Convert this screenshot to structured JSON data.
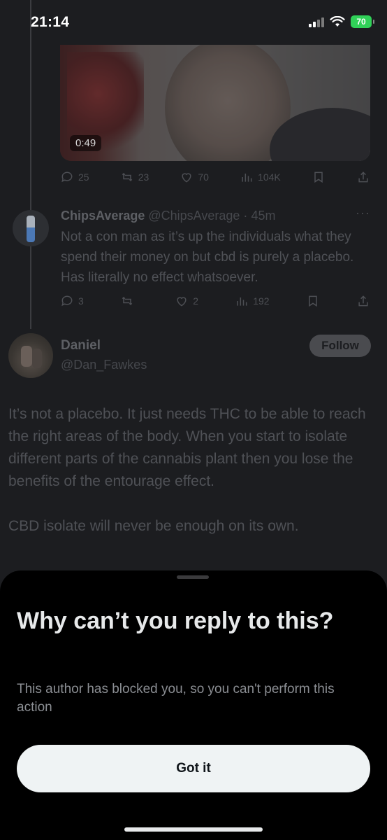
{
  "status_bar": {
    "time": "21:14",
    "battery": "70"
  },
  "media": {
    "duration": "0:49"
  },
  "first_actions": {
    "replies": "25",
    "reposts": "23",
    "likes": "70",
    "views": "104K"
  },
  "reply_tweet": {
    "name": "ChipsAverage",
    "handle": "@ChipsAverage",
    "dot": "·",
    "time": "45m",
    "more": "···",
    "text": "Not a con man as it’s up the individuals what they spend their money on but cbd is purely a placebo. Has literally no effect whatsoever.",
    "replies": "3",
    "reposts": "",
    "likes": "2",
    "views": "192"
  },
  "main_tweet": {
    "name": "Daniel",
    "handle": "@Dan_Fawkes",
    "follow_label": "Follow",
    "paragraph1": "It’s not a placebo. It just needs THC to be able to reach the right areas of the body. When you start to isolate different parts of the cannabis plant then you lose the benefits of the entourage effect.",
    "paragraph2": "CBD isolate will never be enough on its own."
  },
  "sheet": {
    "title": "Why can’t you reply to this?",
    "description": "This author has blocked you, so you can't perform this action",
    "button_label": "Got it"
  },
  "colors": {
    "accent_button": "#eff3f4",
    "sheet_bg": "#000000",
    "battery": "#30d158"
  }
}
